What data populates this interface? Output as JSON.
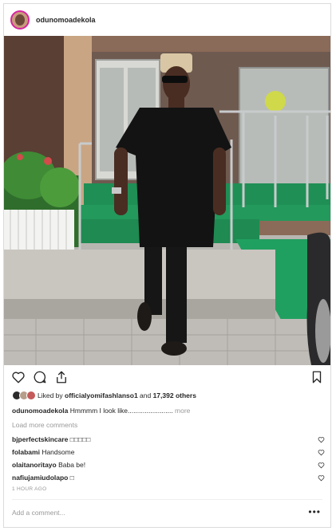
{
  "post": {
    "username": "odunomoadekola",
    "photo_alt": "Man in black outfit walking down steps",
    "likes": {
      "prefix": "Liked by ",
      "user": "officialyomifashlanso1",
      "middle": " and ",
      "count": "17,392 others"
    },
    "caption": {
      "user": "odunomoadekola",
      "text": " Hmmmm I look like........................",
      "more": " more"
    },
    "load_more": "Load more comments",
    "comments": [
      {
        "user": "bjperfectskincare",
        "text": " □□□□□"
      },
      {
        "user": "folabami",
        "text": " Handsome"
      },
      {
        "user": "olaitanoritayo",
        "text": " Baba be!"
      },
      {
        "user": "nafiujamiudolapo",
        "text": " □"
      }
    ],
    "timestamp": "1 HOUR AGO",
    "add_comment_placeholder": "Add a comment...",
    "more_options": "•••"
  },
  "colors": {
    "story_ring": "#d6249f",
    "muted": "#999999",
    "text": "#262626",
    "border": "#dbdbdb"
  },
  "icons": [
    "heart-icon",
    "comment-icon",
    "share-icon",
    "bookmark-icon",
    "small-heart-icon"
  ]
}
